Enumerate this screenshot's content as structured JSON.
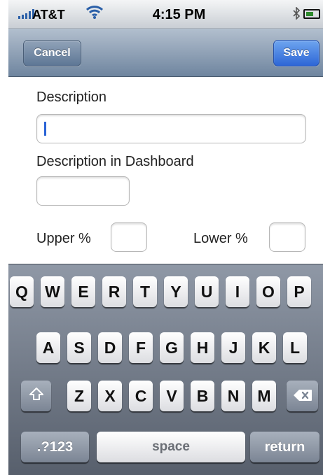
{
  "status_bar": {
    "carrier": "AT&T",
    "time": "4:15 PM",
    "bluetooth_icon": "bluetooth-icon",
    "battery_icon": "battery-icon",
    "wifi_icon": "wifi-icon"
  },
  "nav": {
    "cancel_label": "Cancel",
    "save_label": "Save",
    "save_color": "#3a74e0"
  },
  "form": {
    "description_label": "Description",
    "description_value": "",
    "dashboard_label": "Description in Dashboard",
    "dashboard_value": "",
    "upper_label": "Upper %",
    "upper_value": "",
    "lower_label": "Lower %",
    "lower_value": ""
  },
  "keyboard": {
    "row1": [
      "Q",
      "W",
      "E",
      "R",
      "T",
      "Y",
      "U",
      "I",
      "O",
      "P"
    ],
    "row2": [
      "A",
      "S",
      "D",
      "F",
      "G",
      "H",
      "J",
      "K",
      "L"
    ],
    "row3": [
      "Z",
      "X",
      "C",
      "V",
      "B",
      "N",
      "M"
    ],
    "shift_icon": "shift-icon",
    "delete_icon": "delete-icon",
    "numbers_label": ".?123",
    "space_label": "space",
    "return_label": "return"
  }
}
